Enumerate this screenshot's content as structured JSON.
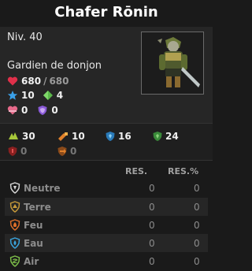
{
  "title": "Chafer Rōnin",
  "level": "Niv. 40",
  "role": "Gardien de donjon",
  "hp": {
    "current": "680",
    "sep": "/",
    "max": "680"
  },
  "ap": "10",
  "mp": "4",
  "erosion": "0",
  "shield": "0",
  "secondary": [
    {
      "icon": "initiative-icon",
      "value": "30"
    },
    {
      "icon": "ap-loss-icon",
      "value": "10"
    },
    {
      "icon": "mp-dodge-icon",
      "value": "16"
    },
    {
      "icon": "mp-loss-icon",
      "value": "24"
    },
    {
      "icon": "damage-red-icon",
      "value": "0"
    },
    {
      "icon": "damage-orange-icon",
      "value": "0"
    }
  ],
  "headers": {
    "res": "RES.",
    "res_pct": "RES.%"
  },
  "elements": [
    {
      "name": "Neutre",
      "res": "0",
      "res_pct": "0",
      "color": "#d8d8d8"
    },
    {
      "name": "Terre",
      "res": "0",
      "res_pct": "0",
      "color": "#c79a3a"
    },
    {
      "name": "Feu",
      "res": "0",
      "res_pct": "0",
      "color": "#e0702a"
    },
    {
      "name": "Eau",
      "res": "0",
      "res_pct": "0",
      "color": "#3aa6e0"
    },
    {
      "name": "Air",
      "res": "0",
      "res_pct": "0",
      "color": "#7fc24a"
    }
  ]
}
